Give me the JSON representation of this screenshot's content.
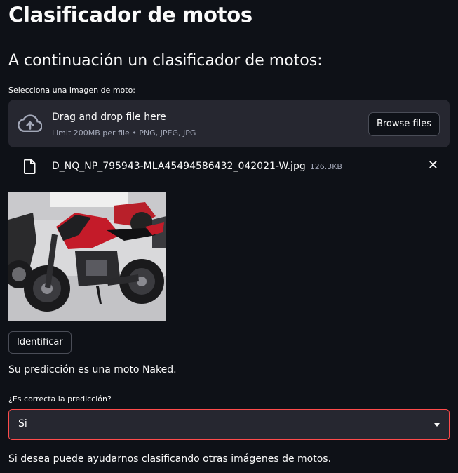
{
  "title": "Clasificador de motos",
  "subtitle": "A continuación un clasificador de motos:",
  "uploader": {
    "label": "Selecciona una imagen de moto:",
    "drop_title": "Drag and drop file here",
    "drop_limit": "Limit 200MB per file • PNG, JPEG, JPG",
    "browse_label": "Browse files"
  },
  "file": {
    "name": "D_NQ_NP_795943-MLA45494586432_042021-W.jpg",
    "size": "126.3KB",
    "remove_symbol": "✕"
  },
  "image": {
    "description": "Red and black naked motorcycle in a showroom"
  },
  "identify_button": "Identificar",
  "prediction_text": "Su predicción es una moto Naked.",
  "feedback": {
    "label": "¿Es correcta la predicción?",
    "selected": "Si"
  },
  "footer_text": "Si desea puede ayudarnos clasificando otras imágenes de motos.",
  "colors": {
    "background": "#0e1117",
    "surface": "#262730",
    "accent": "#ff4b4b",
    "text": "#fafafa",
    "muted_text": "#a3a8b8"
  },
  "icons": {
    "upload": "cloud-upload-icon",
    "file": "file-icon",
    "remove": "close-icon",
    "dropdown": "caret-down-icon"
  }
}
